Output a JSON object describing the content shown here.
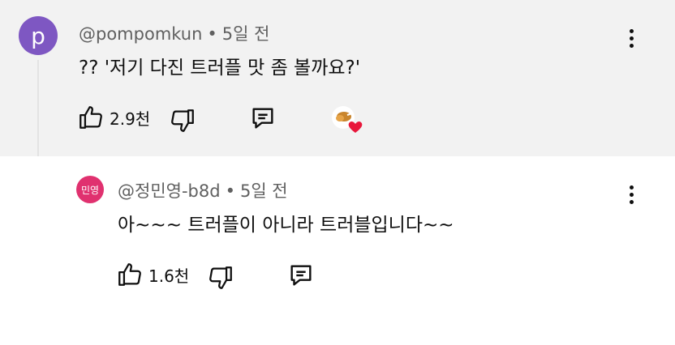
{
  "main_comment": {
    "avatar_letter": "p",
    "handle": "@pompomkun",
    "time": "5일 전",
    "text": "?? '저기 다진 트러플 맛 좀 볼까요?'",
    "likes": "2.9천"
  },
  "reply": {
    "avatar_text": "민영",
    "handle": "@정민영-b8d",
    "time": "5일 전",
    "text": "아~~~ 트러플이 아니라 트러블입니다~~",
    "likes": "1.6천"
  },
  "colors": {
    "main_bg": "#f2f2f2",
    "avatar_main": "#7e57c2",
    "avatar_reply": "#e0316f",
    "heart": "#e8173b"
  },
  "icons": [
    "thumb-up-icon",
    "thumb-down-icon",
    "reply-icon",
    "more-vert-icon",
    "creator-heart-icon"
  ]
}
